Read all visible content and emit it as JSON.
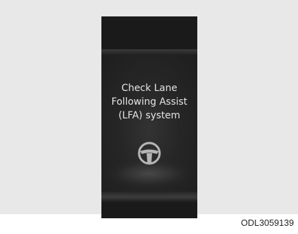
{
  "display": {
    "message_lines": [
      "Check Lane",
      "Following Assist",
      "(LFA) system"
    ],
    "icon": "steering-wheel-icon"
  },
  "figure_code": "ODL3059139",
  "colors": {
    "panel": "#1a1a1a",
    "text": "#e6e6e6",
    "icon": "#b5b5b5",
    "background": "#e8e8e8"
  }
}
